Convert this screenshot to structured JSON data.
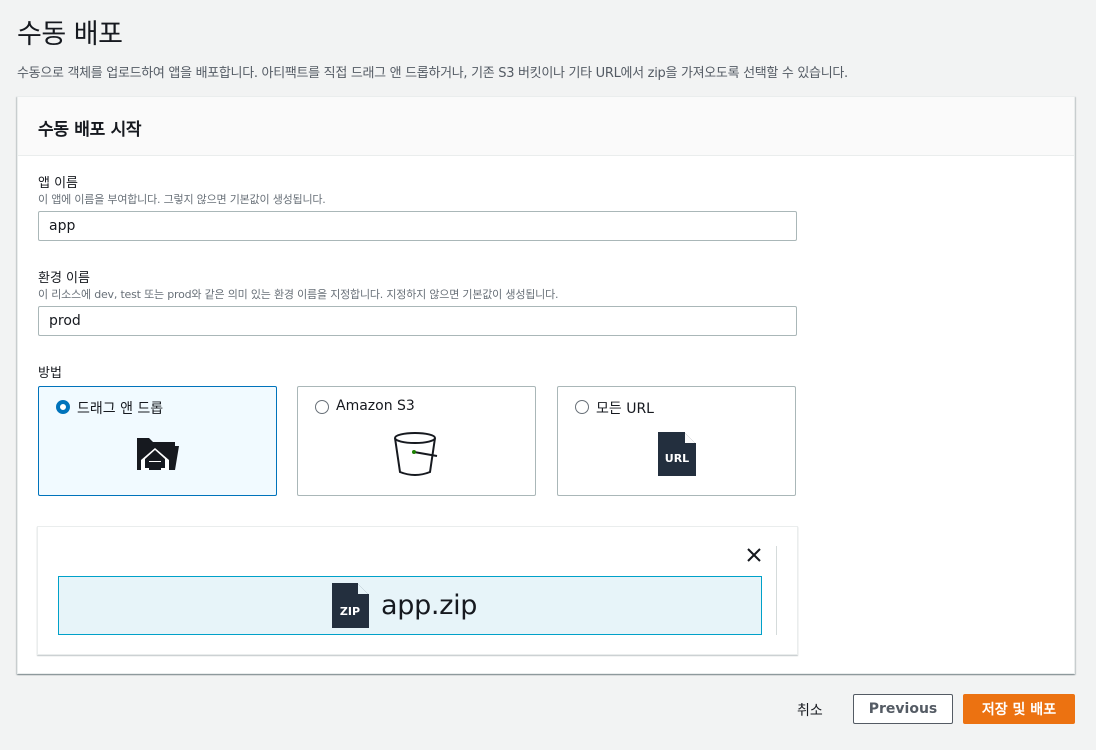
{
  "page": {
    "title": "수동 배포",
    "description": "수동으로 객체를 업로드하여 앱을 배포합니다. 아티팩트를 직접 드래그 앤 드롭하거나, 기존 S3 버킷이나 기타 URL에서 zip을 가져오도록 선택할 수 있습니다."
  },
  "panel": {
    "title": "수동 배포 시작"
  },
  "app_name": {
    "label": "앱 이름",
    "description": "이 앱에 이름을 부여합니다. 그렇지 않으면 기본값이 생성됩니다.",
    "value": "app"
  },
  "env_name": {
    "label": "환경 이름",
    "description": "이 리소스에 dev, test 또는 prod와 같은 의미 있는 환경 이름을 지정합니다. 지정하지 않으면 기본값이 생성됩니다.",
    "value": "prod"
  },
  "method": {
    "label": "방법",
    "options": [
      {
        "label": "드래그 앤 드롭",
        "icon": "folder-upload-icon",
        "selected": true
      },
      {
        "label": "Amazon S3",
        "icon": "s3-bucket-icon",
        "selected": false
      },
      {
        "label": "모든 URL",
        "icon": "url-file-icon",
        "selected": false
      }
    ]
  },
  "upload": {
    "file_name": "app.zip",
    "file_icon_text": "ZIP",
    "url_icon_text": "URL"
  },
  "footer": {
    "cancel_label": "취소",
    "previous_label": "Previous",
    "submit_label": "저장 및 배포"
  },
  "colors": {
    "accent_blue": "#0073bb",
    "primary_orange": "#ec7211",
    "selected_bg": "#f1faff",
    "file_box_bg": "#e7f4f9",
    "file_box_border": "#00a1c9",
    "page_bg": "#f2f3f3"
  }
}
